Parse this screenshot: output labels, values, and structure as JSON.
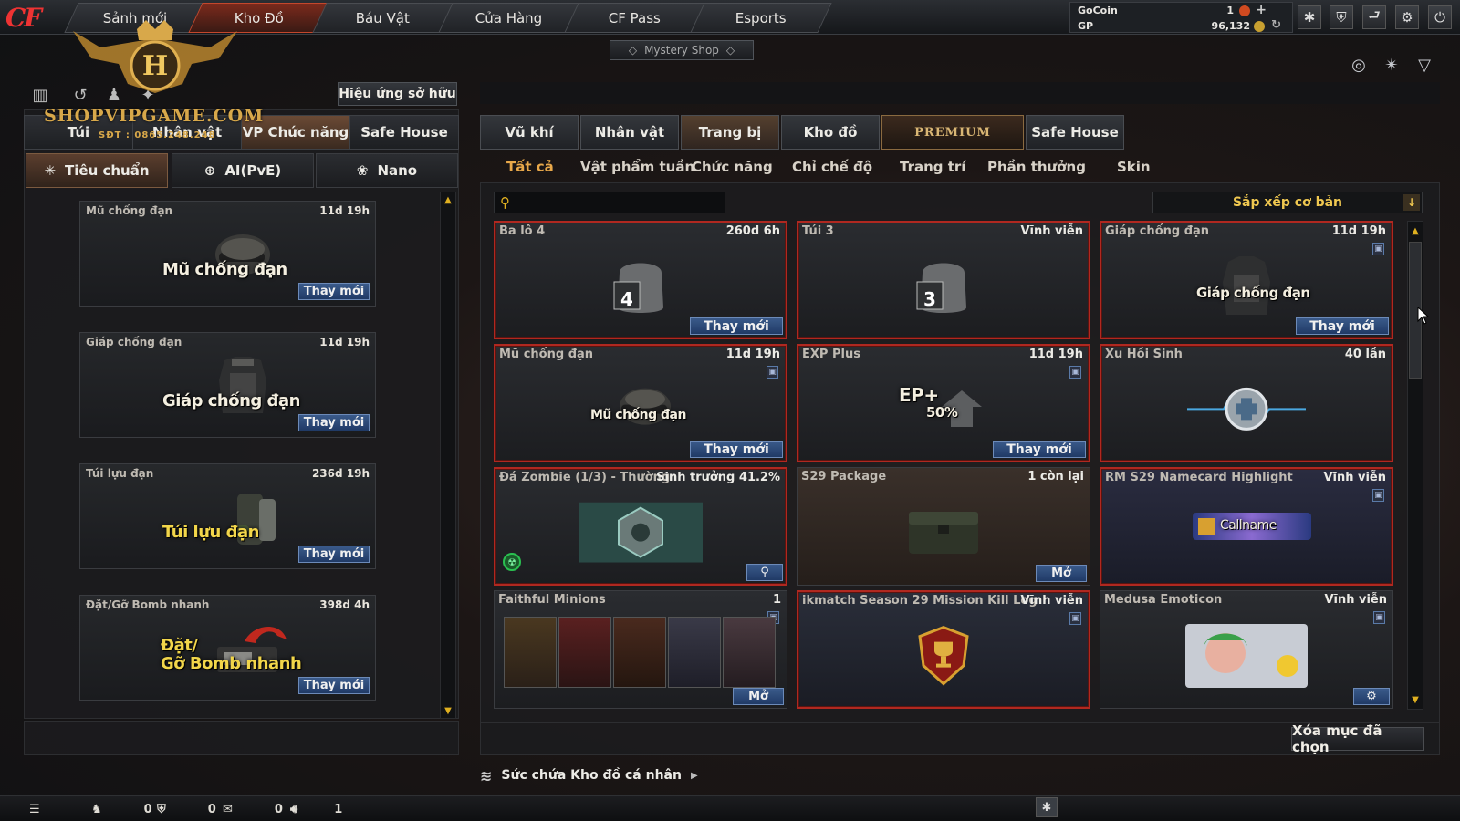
{
  "nav": {
    "tabs": [
      "Sảnh mới",
      "Kho Đồ",
      "Báu Vật",
      "Cửa Hàng",
      "CF Pass",
      "Esports"
    ],
    "active_tab": "Kho Đồ",
    "mystery_shop": "Mystery Shop"
  },
  "currency": {
    "gocoin_label": "GoCoin",
    "gocoin_value": "1",
    "gp_label": "GP",
    "gp_value": "96,132"
  },
  "watermark": {
    "text": "SHOPVIPGAME.COM",
    "phone": "SĐT : 0865.248.248",
    "emblem_letter": "H"
  },
  "left": {
    "effect_button": "Hiệu ứng sở hữu",
    "tabs": [
      "Túi",
      "Nhân vật",
      "VP Chức năng",
      "Safe House"
    ],
    "mode_tabs": [
      "Tiêu chuẩn",
      "AI(PvE)",
      "Nano"
    ],
    "cards": [
      {
        "name": "Mũ chống đạn",
        "time": "11d 19h",
        "label": "Mũ chống đạn",
        "button": "Thay mới"
      },
      {
        "name": "Giáp chống đạn",
        "time": "11d 19h",
        "label": "Giáp chống đạn",
        "button": "Thay mới"
      },
      {
        "name": "Túi lựu đạn",
        "time": "236d 19h",
        "label": "Túi lựu đạn",
        "button": "Thay mới"
      },
      {
        "name": "Đặt/Gỡ Bomb nhanh",
        "time": "398d 4h",
        "label_line1": "Đặt/",
        "label_line2": "Gỡ Bomb nhanh",
        "button": "Thay mới"
      }
    ]
  },
  "right": {
    "tabs": [
      "Vũ khí",
      "Nhân vật",
      "Trang bị",
      "Kho đồ",
      "PREMIUM",
      "Safe House"
    ],
    "active_tab": "Trang bị",
    "subtabs": [
      "Tất cả",
      "Vật phẩm tuần",
      "Chức năng",
      "Chỉ chế độ",
      "Trang trí",
      "Phần thưởng",
      "Skin"
    ],
    "active_subtab": "Tất cả",
    "search_placeholder": "",
    "sort_label": "Sắp xếp cơ bản",
    "items": [
      {
        "name": "Ba lô 4",
        "time": "260d 6h",
        "button": "Thay mới",
        "badge": "4"
      },
      {
        "name": "Túi 3",
        "time": "Vĩnh viễn",
        "badge": "3"
      },
      {
        "name": "Giáp chống đạn",
        "time": "11d 19h",
        "button": "Thay mới",
        "caption": "Giáp chống đạn"
      },
      {
        "name": "Mũ chống đạn",
        "time": "11d 19h",
        "button": "Thay mới",
        "caption": "Mũ chống đạn"
      },
      {
        "name": "EXP Plus",
        "time": "11d 19h",
        "button": "Thay mới",
        "caption_top": "EP+",
        "caption_pct": "50%"
      },
      {
        "name": "Xu Hồi Sinh",
        "time": "40 lần"
      },
      {
        "name": "Đá Zombie (1/3) - Thường",
        "time": "Sinh trưởng 41.2%"
      },
      {
        "name": "S29 Package",
        "time": "1 còn lại",
        "button": "Mở"
      },
      {
        "name": "RM S29 Namecard Highlight",
        "time": "Vĩnh viễn",
        "caption": "Callname"
      },
      {
        "name": "Faithful Minions",
        "time": "1",
        "button": "Mở"
      },
      {
        "name": "ikmatch Season 29 Mission Kill Log",
        "time": "Vĩnh viễn"
      },
      {
        "name": "Medusa Emoticon",
        "time": "Vĩnh viễn"
      }
    ],
    "delete_button": "Xóa mục đã chọn",
    "capacity_label": "Sức chứa Kho đồ cá nhân"
  },
  "bottom": {
    "count1": "0",
    "count2": "0",
    "count3": "0",
    "count4": "1"
  }
}
